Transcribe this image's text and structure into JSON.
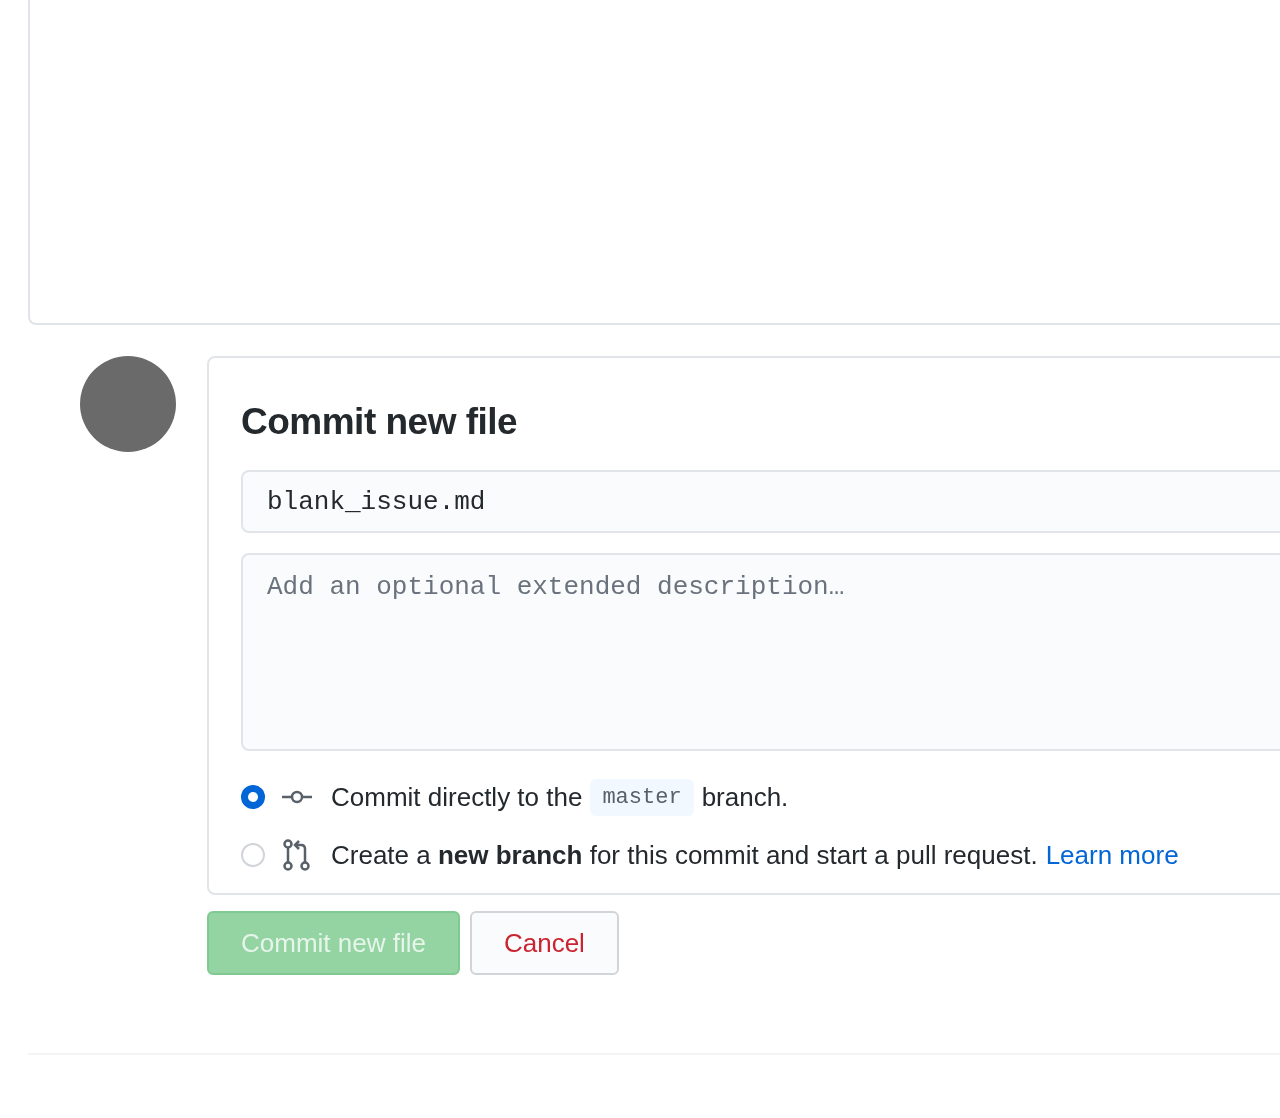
{
  "commit_form": {
    "title": "Commit new file",
    "summary_field": {
      "value": "blank_issue.md"
    },
    "description_field": {
      "placeholder": "Add an optional extended description…"
    },
    "options": [
      {
        "kind": "direct",
        "selected": true,
        "parts": [
          {
            "kind": "text",
            "text": "Commit directly to the"
          },
          {
            "kind": "code",
            "text": "master"
          },
          {
            "kind": "text",
            "text": "branch."
          }
        ]
      },
      {
        "kind": "new-branch",
        "selected": false,
        "parts": [
          {
            "kind": "text",
            "text": "Create a **new branch** for this commit and start a pull request."
          },
          {
            "kind": "link",
            "text": "Learn more"
          }
        ]
      }
    ],
    "buttons": [
      {
        "kind": "primary",
        "label": "Commit new file",
        "disabled": true
      },
      {
        "kind": "cancel",
        "label": "Cancel",
        "disabled": false
      }
    ]
  }
}
